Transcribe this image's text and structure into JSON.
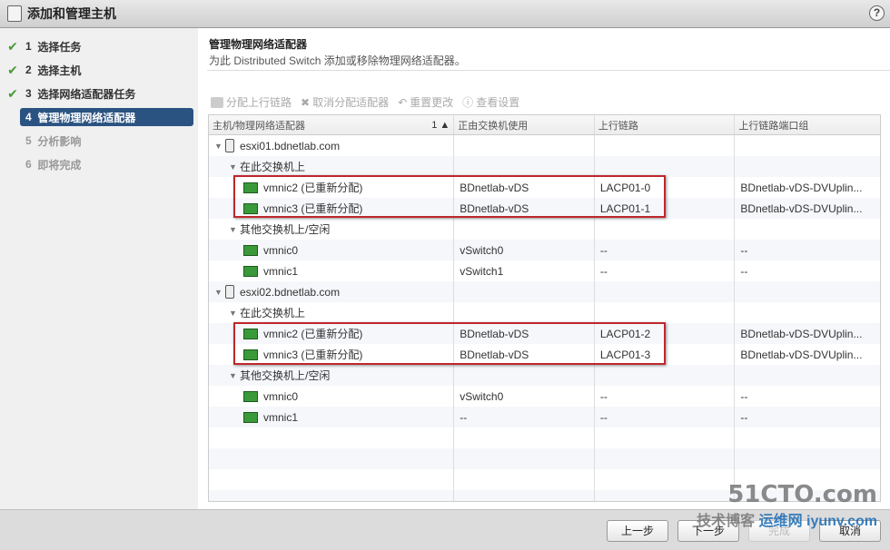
{
  "title": "添加和管理主机",
  "steps": [
    {
      "num": "1",
      "label": "选择任务",
      "state": "done"
    },
    {
      "num": "2",
      "label": "选择主机",
      "state": "done"
    },
    {
      "num": "3",
      "label": "选择网络适配器任务",
      "state": "done"
    },
    {
      "num": "4",
      "label": "管理物理网络适配器",
      "state": "active"
    },
    {
      "num": "5",
      "label": "分析影响",
      "state": "disabled"
    },
    {
      "num": "6",
      "label": "即将完成",
      "state": "disabled"
    }
  ],
  "main": {
    "title": "管理物理网络适配器",
    "subtitle": "为此 Distributed Switch 添加或移除物理网络适配器。"
  },
  "toolbar": {
    "assign": "分配上行链路",
    "unassign": "取消分配适配器",
    "reset": "重置更改",
    "view": "查看设置"
  },
  "table": {
    "headers": [
      "主机/物理网络适配器",
      "正由交换机使用",
      "上行链路",
      "上行链路端口组"
    ],
    "sort": "1 ▲",
    "rows": [
      {
        "type": "host",
        "name": "esxi01.bdnetlab.com",
        "sw": "",
        "up": "",
        "pg": ""
      },
      {
        "type": "group",
        "name": "在此交换机上",
        "sw": "",
        "up": "",
        "pg": ""
      },
      {
        "type": "nic",
        "name": "vmnic2 (已重新分配)",
        "sw": "BDnetlab-vDS",
        "up": "LACP01-0",
        "pg": "BDnetlab-vDS-DVUplin..."
      },
      {
        "type": "nic",
        "name": "vmnic3 (已重新分配)",
        "sw": "BDnetlab-vDS",
        "up": "LACP01-1",
        "pg": "BDnetlab-vDS-DVUplin..."
      },
      {
        "type": "group",
        "name": "其他交换机上/空闲",
        "sw": "",
        "up": "",
        "pg": ""
      },
      {
        "type": "nic",
        "name": "vmnic0",
        "sw": "vSwitch0",
        "up": "--",
        "pg": "--"
      },
      {
        "type": "nic",
        "name": "vmnic1",
        "sw": "vSwitch1",
        "up": "--",
        "pg": "--"
      },
      {
        "type": "host",
        "name": "esxi02.bdnetlab.com",
        "sw": "",
        "up": "",
        "pg": ""
      },
      {
        "type": "group",
        "name": "在此交换机上",
        "sw": "",
        "up": "",
        "pg": ""
      },
      {
        "type": "nic",
        "name": "vmnic2 (已重新分配)",
        "sw": "BDnetlab-vDS",
        "up": "LACP01-2",
        "pg": "BDnetlab-vDS-DVUplin..."
      },
      {
        "type": "nic",
        "name": "vmnic3 (已重新分配)",
        "sw": "BDnetlab-vDS",
        "up": "LACP01-3",
        "pg": "BDnetlab-vDS-DVUplin..."
      },
      {
        "type": "group",
        "name": "其他交换机上/空闲",
        "sw": "",
        "up": "",
        "pg": ""
      },
      {
        "type": "nic",
        "name": "vmnic0",
        "sw": "vSwitch0",
        "up": "--",
        "pg": "--"
      },
      {
        "type": "nic",
        "name": "vmnic1",
        "sw": "--",
        "up": "--",
        "pg": "--"
      }
    ]
  },
  "footer": {
    "back": "上一步",
    "next": "下一步",
    "finish": "完成",
    "cancel": "取消"
  },
  "watermark": {
    "line1": "51CTO.com",
    "line2": "技术博客",
    "line3": "运维网 iyunv.com"
  }
}
